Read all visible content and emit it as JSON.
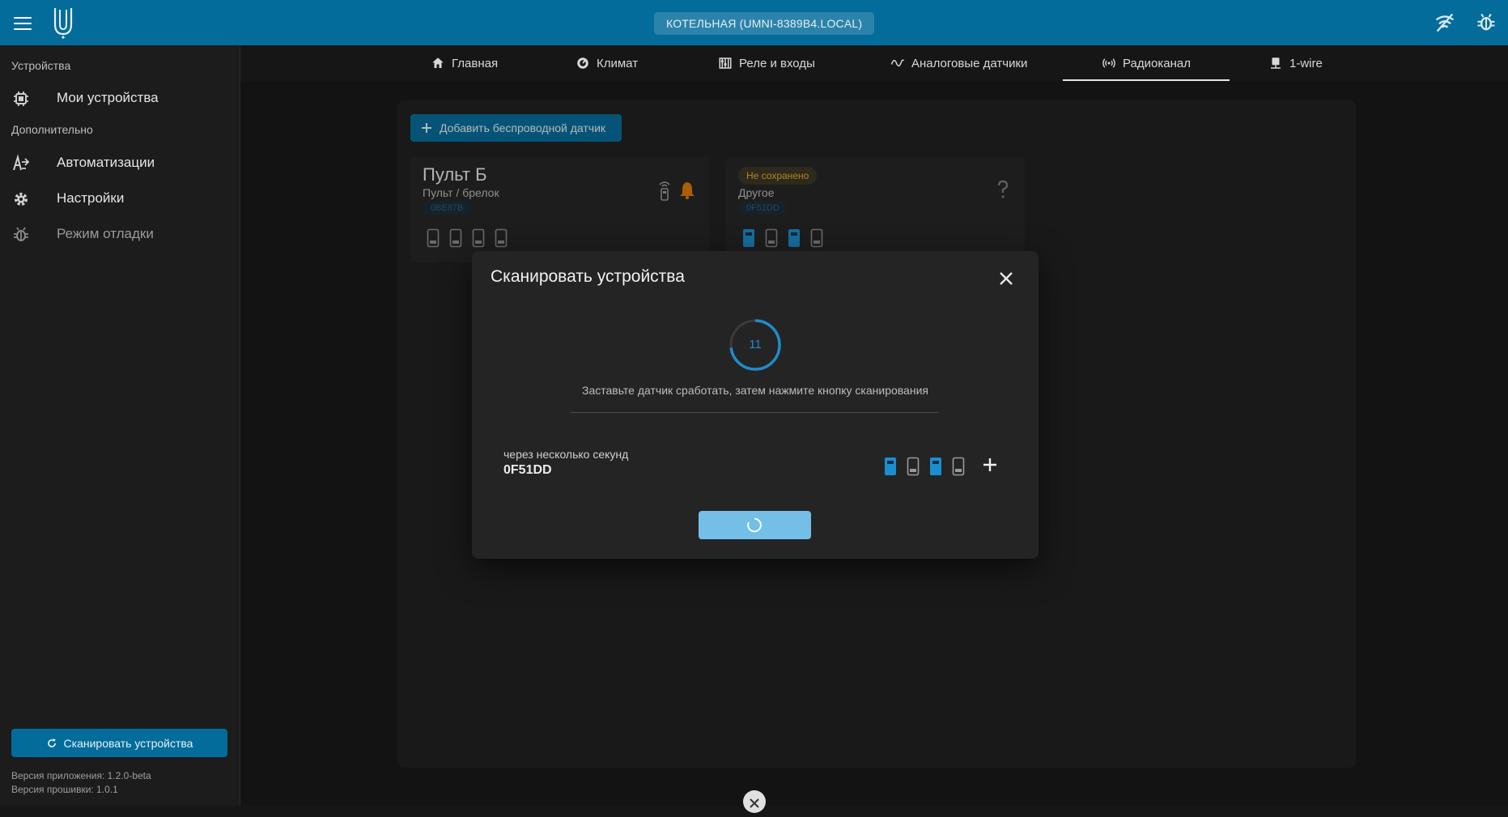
{
  "header": {
    "host": "КОТЕЛЬНАЯ (UMNI-8389B4.LOCAL)",
    "icons": [
      "menu-icon",
      "logo",
      "wifi-off-icon",
      "debug-icon"
    ]
  },
  "sidebar": {
    "section_devices": "Устройства",
    "my_devices": "Мои устройства",
    "section_extra": "Дополнительно",
    "automations": "Автоматизации",
    "settings": "Настройки",
    "debug_mode": "Режим отладки",
    "scan_button": "Сканировать устройства",
    "app_version": "Версия приложения: 1.2.0-beta",
    "firmware_version": "Версия прошивки: 1.0.1"
  },
  "tabs": [
    {
      "label": "Главная",
      "icon": "home-icon"
    },
    {
      "label": "Климат",
      "icon": "thermostat-icon"
    },
    {
      "label": "Реле и входы",
      "icon": "relay-icon"
    },
    {
      "label": "Аналоговые датчики",
      "icon": "wave-icon"
    },
    {
      "label": "Радиоканал",
      "icon": "radio-icon",
      "active": true
    },
    {
      "label": "1-wire",
      "icon": "one-wire-icon"
    }
  ],
  "main": {
    "add_button": "Добавить беспроводной датчик",
    "cards": [
      {
        "title": "Пульт Б",
        "type": "Пульт / брелок",
        "id": "0BE87B",
        "buttons_active": [
          false,
          false,
          false,
          false
        ]
      },
      {
        "badge": "Не сохранено",
        "type": "Другое",
        "id": "0F51DD",
        "buttons_active": [
          true,
          false,
          true,
          false
        ]
      }
    ]
  },
  "dialog": {
    "title": "Сканировать устройства",
    "countdown": "11",
    "countdown_progress": 0.73,
    "hint": "Заставьте датчик сработать, затем нажмите кнопку сканирования",
    "result_label": "через несколько секунд",
    "result_id": "0F51DD",
    "result_buttons_active": [
      true,
      false,
      true,
      false
    ]
  },
  "colors": {
    "accent": "#036c9b",
    "active_button": "#1a8fd0",
    "warning": "#e3b030",
    "bell": "#e07b00"
  }
}
